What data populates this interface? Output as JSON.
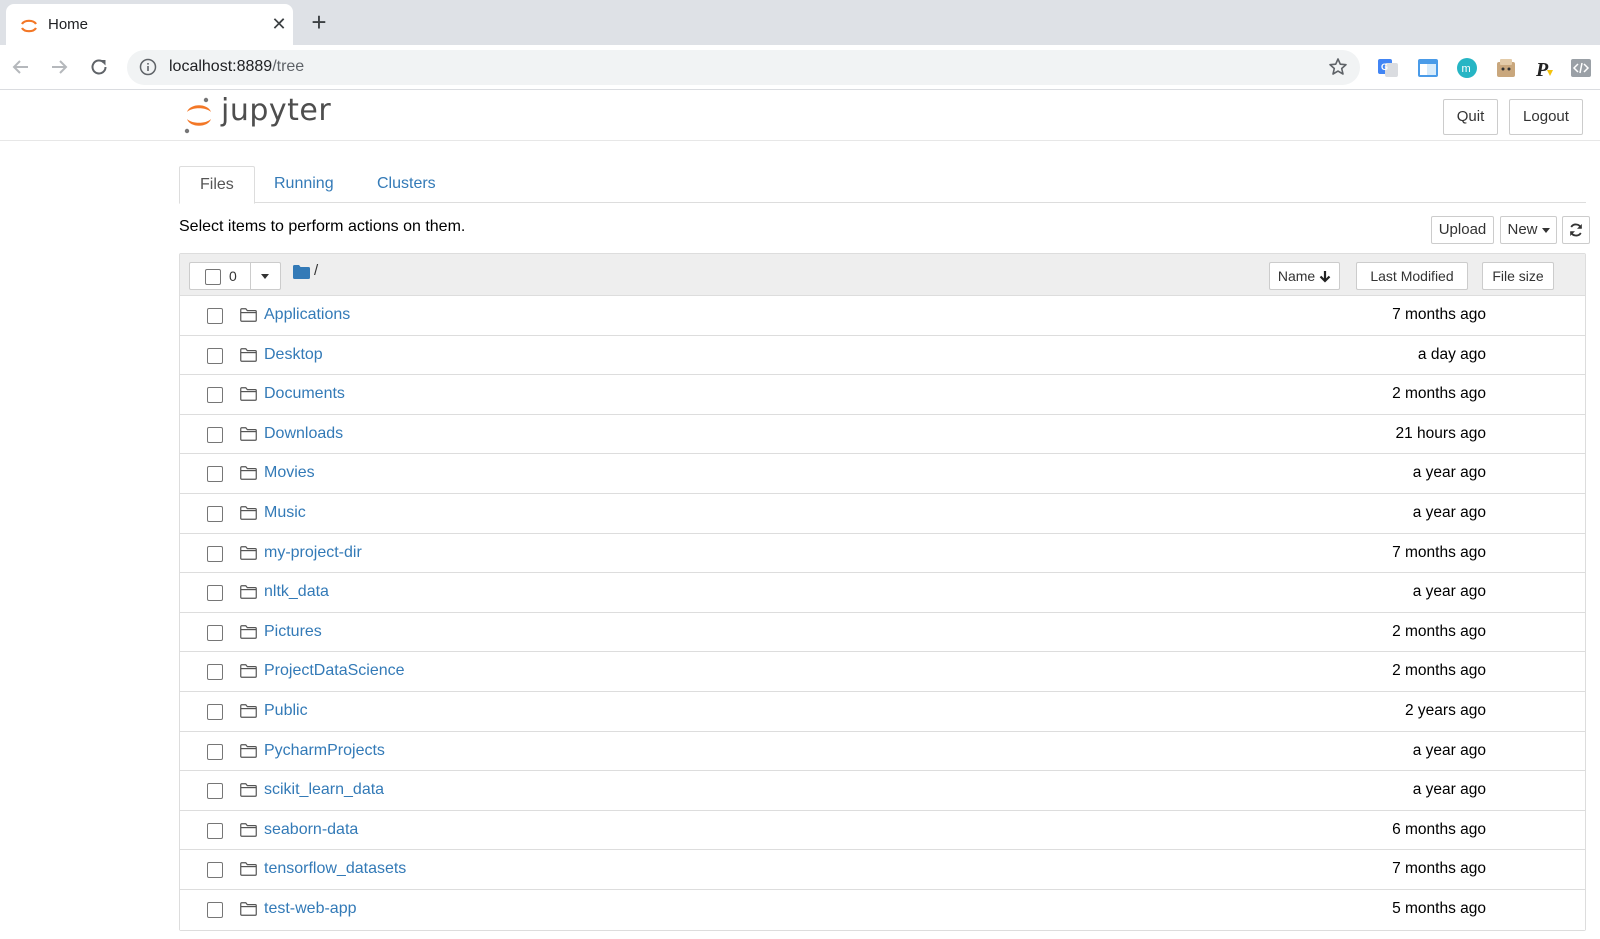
{
  "browser": {
    "tab_title": "Home",
    "new_tab_symbol": "+",
    "close_symbol": "✕",
    "url_host": "localhost:8889",
    "url_path": "/tree",
    "extensions": [
      "google-translate-icon",
      "window-extension-icon",
      "m-circle-extension-icon",
      "box-extension-icon",
      "p-extension-icon",
      "code-extension-icon"
    ]
  },
  "header": {
    "logo_text": "jupyter",
    "quit_label": "Quit",
    "logout_label": "Logout"
  },
  "tabs": [
    {
      "label": "Files",
      "active": true
    },
    {
      "label": "Running",
      "active": false
    },
    {
      "label": "Clusters",
      "active": false
    }
  ],
  "toolbar": {
    "hint": "Select items to perform actions on them.",
    "upload_label": "Upload",
    "new_label": "New"
  },
  "list_header": {
    "selected_count": "0",
    "breadcrumb": "/",
    "sort_name": "Name",
    "sort_modified": "Last Modified",
    "sort_size": "File size"
  },
  "files": [
    {
      "name": "Applications",
      "modified": "7 months ago"
    },
    {
      "name": "Desktop",
      "modified": "a day ago"
    },
    {
      "name": "Documents",
      "modified": "2 months ago"
    },
    {
      "name": "Downloads",
      "modified": "21 hours ago"
    },
    {
      "name": "Movies",
      "modified": "a year ago"
    },
    {
      "name": "Music",
      "modified": "a year ago"
    },
    {
      "name": "my-project-dir",
      "modified": "7 months ago"
    },
    {
      "name": "nltk_data",
      "modified": "a year ago"
    },
    {
      "name": "Pictures",
      "modified": "2 months ago"
    },
    {
      "name": "ProjectDataScience",
      "modified": "2 months ago"
    },
    {
      "name": "Public",
      "modified": "2 years ago"
    },
    {
      "name": "PycharmProjects",
      "modified": "a year ago"
    },
    {
      "name": "scikit_learn_data",
      "modified": "a year ago"
    },
    {
      "name": "seaborn-data",
      "modified": "6 months ago"
    },
    {
      "name": "tensorflow_datasets",
      "modified": "7 months ago"
    },
    {
      "name": "test-web-app",
      "modified": "5 months ago"
    }
  ],
  "colors": {
    "link": "#337ab7",
    "jupyter_orange": "#f37726"
  }
}
